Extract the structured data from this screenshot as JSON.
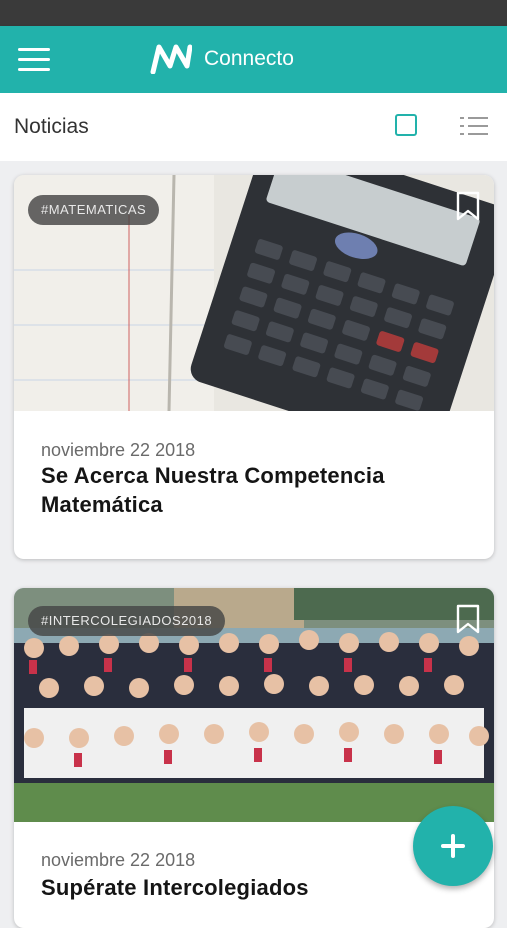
{
  "app": {
    "name": "Connecto"
  },
  "section": {
    "title": "Noticias"
  },
  "colors": {
    "accent": "#22b2ab",
    "status_bar": "#3a3a3a"
  },
  "icons": {
    "menu": "hamburger-menu-icon",
    "logo": "connecto-logo-icon",
    "grid_view": "grid-view-icon",
    "list_view": "list-view-icon",
    "bookmark": "bookmark-icon",
    "add": "plus-icon"
  },
  "news": [
    {
      "tag": "#MATEMATICAS",
      "date": "noviembre 22 2018",
      "title": "Se Acerca Nuestra Competencia Matemática",
      "image": "calculator-photo"
    },
    {
      "tag": "#INTERCOLEGIADOS2018",
      "date": "noviembre 22 2018",
      "title": "Supérate Intercolegiados",
      "image": "team-group-photo"
    }
  ]
}
